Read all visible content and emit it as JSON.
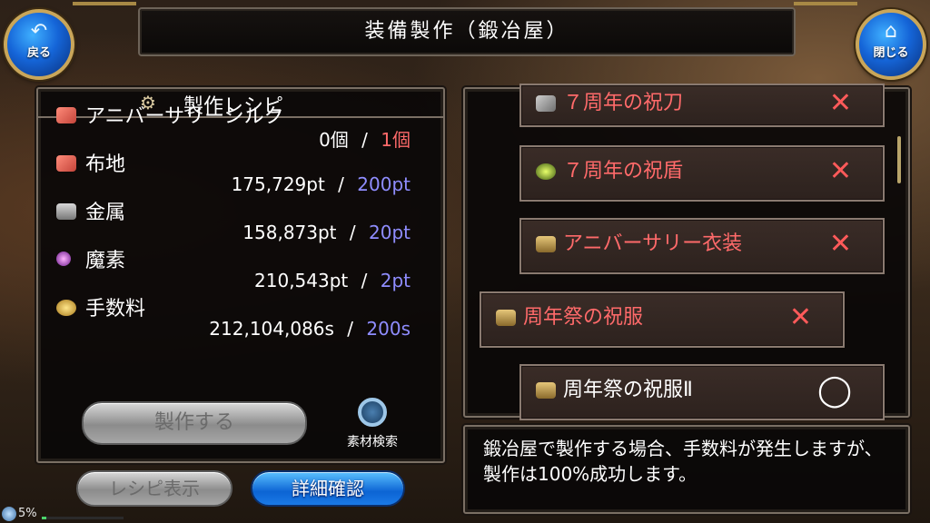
{
  "header": {
    "title": "装備製作（鍛冶屋）",
    "back_label": "戻る",
    "close_label": "閉じる"
  },
  "recipe_panel": {
    "title": "製作レシピ",
    "materials": [
      {
        "name": "アニバーサリーシルク",
        "have": "0個",
        "need": "1個",
        "need_color": "#ff6a6a",
        "icon": "silk-icon"
      },
      {
        "name": "布地",
        "have": "175,729pt",
        "need": "200pt",
        "need_color": "#8f8dff",
        "icon": "cloth-icon"
      },
      {
        "name": "金属",
        "have": "158,873pt",
        "need": "20pt",
        "need_color": "#8f8dff",
        "icon": "metal-icon"
      },
      {
        "name": "魔素",
        "have": "210,543pt",
        "need": "2pt",
        "need_color": "#8f8dff",
        "icon": "mana-icon"
      },
      {
        "name": "手数料",
        "have": "212,104,086s",
        "need": "200s",
        "need_color": "#8f8dff",
        "icon": "coin-icon"
      }
    ],
    "separator": "/",
    "craft_button": "製作する",
    "search_label": "素材検索"
  },
  "bottom_buttons": {
    "recipe_display": "レシピ表示",
    "detail_confirm": "詳細確認"
  },
  "status": {
    "percent": "5%",
    "progress": 0.05
  },
  "recipe_list": [
    {
      "name": "７周年の祝刀",
      "mark": "✕",
      "name_color": "#ff6a6a",
      "icon": "sword-icon"
    },
    {
      "name": "７周年の祝盾",
      "mark": "✕",
      "name_color": "#ff6a6a",
      "icon": "shield-icon"
    },
    {
      "name": "アニバーサリー衣装",
      "mark": "✕",
      "name_color": "#ff6a6a",
      "icon": "scroll-icon"
    },
    {
      "name": "周年祭の祝服",
      "mark": "✕",
      "name_color": "#ff6a6a",
      "icon": "scroll-icon",
      "selected": true
    },
    {
      "name": "周年祭の祝服Ⅱ",
      "mark": "◯",
      "name_color": "#ffffff",
      "icon": "scroll-icon"
    }
  ],
  "info_text": "鍛冶屋で製作する場合、手数料が発生しますが、製作は100%成功します。"
}
